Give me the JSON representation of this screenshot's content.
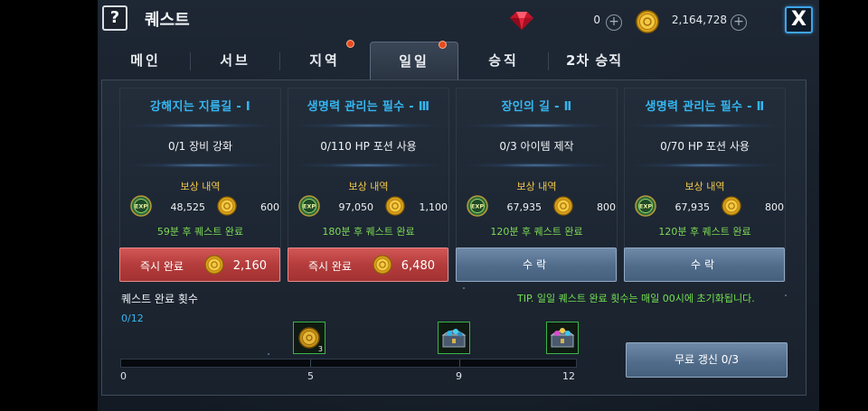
{
  "header": {
    "help_label": "?",
    "title": "퀘스트",
    "gem_count": "0",
    "gold_count": "2,164,728",
    "plus_label": "+",
    "close_label": "X"
  },
  "tabs": [
    {
      "label": "메인",
      "dot": false,
      "active": false
    },
    {
      "label": "서브",
      "dot": false,
      "active": false
    },
    {
      "label": "지역",
      "dot": true,
      "active": false
    },
    {
      "label": "일일",
      "dot": true,
      "active": true
    },
    {
      "label": "승직",
      "dot": false,
      "active": false
    },
    {
      "label": "2차 승직",
      "dot": false,
      "active": false
    }
  ],
  "quests": [
    {
      "title": "강해지는 지름길 - Ⅰ",
      "task": "0/1 장비 강화",
      "reward_label": "보상 내역",
      "exp": "48,525",
      "gold": "600",
      "time": "59분 후 퀘스트 완료",
      "button": {
        "type": "instant",
        "label": "즉시 완료",
        "cost": "2,160"
      }
    },
    {
      "title": "생명력 관리는 필수 - Ⅲ",
      "task": "0/110 HP 포션 사용",
      "reward_label": "보상 내역",
      "exp": "97,050",
      "gold": "1,100",
      "time": "180분 후 퀘스트 완료",
      "button": {
        "type": "instant",
        "label": "즉시 완료",
        "cost": "6,480"
      }
    },
    {
      "title": "장인의 길 - Ⅱ",
      "task": "0/3 아이템 제작",
      "reward_label": "보상 내역",
      "exp": "67,935",
      "gold": "800",
      "time": "120분 후 퀘스트 완료",
      "button": {
        "type": "accept",
        "label": "수락"
      }
    },
    {
      "title": "생명력 관리는 필수 - Ⅱ",
      "task": "0/70 HP 포션 사용",
      "reward_label": "보상 내역",
      "exp": "67,935",
      "gold": "800",
      "time": "120분 후 퀘스트 완료",
      "button": {
        "type": "accept",
        "label": "수락"
      }
    }
  ],
  "progress": {
    "title": "퀘스트 완료 횟수",
    "count": "0/12",
    "value": 0,
    "max": 12,
    "milestones": [
      {
        "at": 5,
        "label": "5",
        "reward_icon": "gold-coin-box-icon",
        "badge": "3"
      },
      {
        "at": 9,
        "label": "9",
        "reward_icon": "blue-treasure-chest-icon",
        "badge": ""
      },
      {
        "at": 12,
        "label": "12",
        "reward_icon": "purple-treasure-chest-icon",
        "badge": ""
      }
    ],
    "start_label": "0"
  },
  "tip": "TIP. 일일 퀘스트 완료 횟수는 매일 00시에 초기화됩니다.",
  "refresh_button": "무료 갱신 0/3",
  "colors": {
    "title_blue": "#35b7f2",
    "reward_gold": "#f2c94c",
    "time_green": "#7ed957",
    "instant_red": "#b53c3c",
    "accept_blue": "#516c8a",
    "tab_dot": "#e64b1e"
  }
}
